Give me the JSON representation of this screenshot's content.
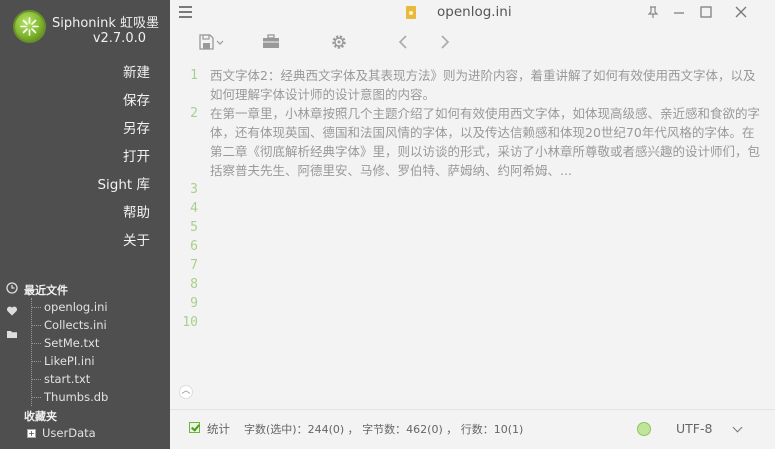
{
  "app": {
    "name": "Siphonink 虹吸墨",
    "version": "v2.7.0.0"
  },
  "sidebar": {
    "menu": [
      {
        "label": "新建"
      },
      {
        "label": "保存"
      },
      {
        "label": "另存"
      },
      {
        "label": "打开"
      },
      {
        "label": "Sight 库"
      },
      {
        "label": "帮助"
      },
      {
        "label": "关于"
      }
    ],
    "recent_title": "最近文件",
    "recent_files": [
      "openlog.ini",
      "Collects.ini",
      "SetMe.txt",
      "LikePI.ini",
      "start.txt",
      "Thumbs.db"
    ],
    "favorites_title": "收藏夹",
    "favorites": [
      "UserData"
    ]
  },
  "titlebar": {
    "document_title": "openlog.ini"
  },
  "editor": {
    "line_numbers": [
      "1",
      "2",
      "3",
      "4",
      "5",
      "6",
      "7",
      "8",
      "9",
      "10"
    ],
    "line1": "西文字体2：经典西文字体及其表现方法》则为进阶内容，着重讲解了如何有效使用西文字体，以及如何理解字体设计师的设计意图的内容。",
    "line2": "在第一章里，小林章按照几个主题介绍了如何有效使用西文字体，如体现高级感、亲近感和食欲的字体，还有体现英国、德国和法国风情的字体，以及传达信赖感和体现20世纪70年代风格的字体。在第二章《彻底解析经典字体》里，则以访谈的形式，采访了小林章所尊敬或者感兴趣的设计师们，包括察普夫先生、阿德里安、马修、罗伯特、萨姆纳、约阿希姆、..."
  },
  "statusbar": {
    "stats_label": "统计",
    "stats_text": "字数(选中)：244(0) ，  字节数：462(0) ，  行数：10(1)",
    "encoding": "UTF-8"
  },
  "colors": {
    "sidebar_bg": "#4f4f4f",
    "main_bg": "#f3f3f3",
    "line_number": "#a8d08d",
    "accent_green": "#7fb52c"
  },
  "icons": [
    "hamburger-icon",
    "file-icon",
    "pin-icon",
    "minimize-icon",
    "maximize-icon",
    "close-icon",
    "save-icon",
    "toolbox-icon",
    "gear-icon",
    "back-icon",
    "forward-icon",
    "clock-icon",
    "heart-icon",
    "folder-icon",
    "globe-icon",
    "chevron-down-icon"
  ]
}
